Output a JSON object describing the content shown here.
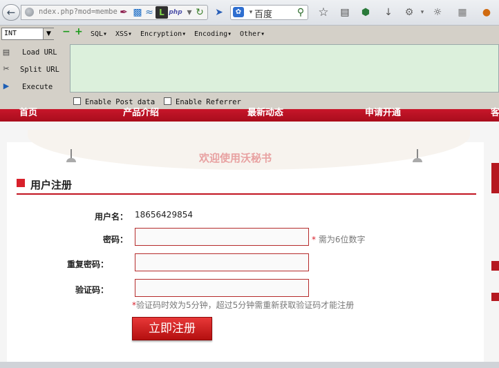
{
  "browser": {
    "url": "ndex.php?mod=membe",
    "search_placeholder": "百度",
    "back_icon": "back-arrow-icon"
  },
  "hackbar": {
    "select_value": "INT",
    "menus": [
      "SQL▾",
      "XSS▾",
      "Encryption▾",
      "Encoding▾",
      "Other▾"
    ],
    "load_url": "Load URL",
    "split_url": "Split URL",
    "execute": "Execute",
    "enable_post": "Enable Post data",
    "enable_referrer": "Enable Referrer"
  },
  "site_nav": [
    "首页",
    "产品介绍",
    "最新动态",
    "申请开通",
    "客"
  ],
  "welcome": "欢迎使用沃秘书",
  "section_title": "用户注册",
  "form": {
    "username_label": "用户名：",
    "username_value": "18656429854",
    "password_label": "密码：",
    "password_hint_star": "*",
    "password_hint": " 需为6位数字",
    "repeat_label": "重复密码：",
    "captcha_label": "验证码：",
    "captcha_hint_star": "*",
    "captcha_hint": "验证码时效为5分钟，超过5分钟需重新获取验证码才能注册",
    "submit": "立即注册"
  },
  "colors": {
    "brand_red": "#c8162a",
    "hackbar_bg": "#d4d0c8",
    "textarea_bg": "#dcf0dc"
  }
}
